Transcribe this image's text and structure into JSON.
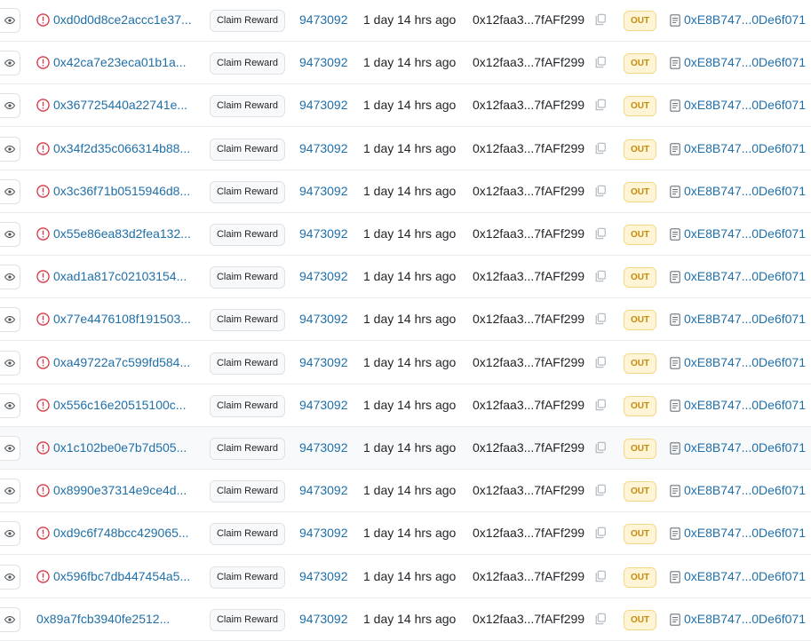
{
  "table": {
    "method_label": "Claim Reward",
    "block": "9473092",
    "age": "1 day 14 hrs ago",
    "from": "0x12faa3...7fAFf299",
    "direction": "OUT",
    "to": "0xE8B747...0De6f071",
    "colors": {
      "link": "#1f6fa8",
      "error": "#dc3545",
      "badge_bg": "#fff5d6",
      "badge_text": "#c08c0a",
      "row_highlight": "#f8f9fa"
    },
    "rows": [
      {
        "hash": "0xd0d0d8ce2accc1e37...",
        "status": "error"
      },
      {
        "hash": "0x42ca7e23eca01b1a...",
        "status": "error"
      },
      {
        "hash": "0x367725440a22741e...",
        "status": "error"
      },
      {
        "hash": "0x34f2d35c066314b88...",
        "status": "error"
      },
      {
        "hash": "0x3c36f71b0515946d8...",
        "status": "error"
      },
      {
        "hash": "0x55e86ea83d2fea132...",
        "status": "error"
      },
      {
        "hash": "0xad1a817c02103154...",
        "status": "error"
      },
      {
        "hash": "0x77e4476108f191503...",
        "status": "error"
      },
      {
        "hash": "0xa49722a7c599fd584...",
        "status": "error"
      },
      {
        "hash": "0x556c16e20515100c...",
        "status": "error"
      },
      {
        "hash": "0x1c102be0e7b7d505...",
        "status": "error",
        "highlighted": true
      },
      {
        "hash": "0x8990e37314e9ce4d...",
        "status": "error"
      },
      {
        "hash": "0xd9c6f748bcc429065...",
        "status": "error"
      },
      {
        "hash": "0x596fbc7db447454a5...",
        "status": "error"
      },
      {
        "hash": "0x89a7fcb3940fe2512...",
        "status": "success"
      }
    ],
    "icons": {
      "view": "eye-icon",
      "error": "error-circle-icon",
      "copy": "copy-icon",
      "contract": "document-icon"
    }
  }
}
